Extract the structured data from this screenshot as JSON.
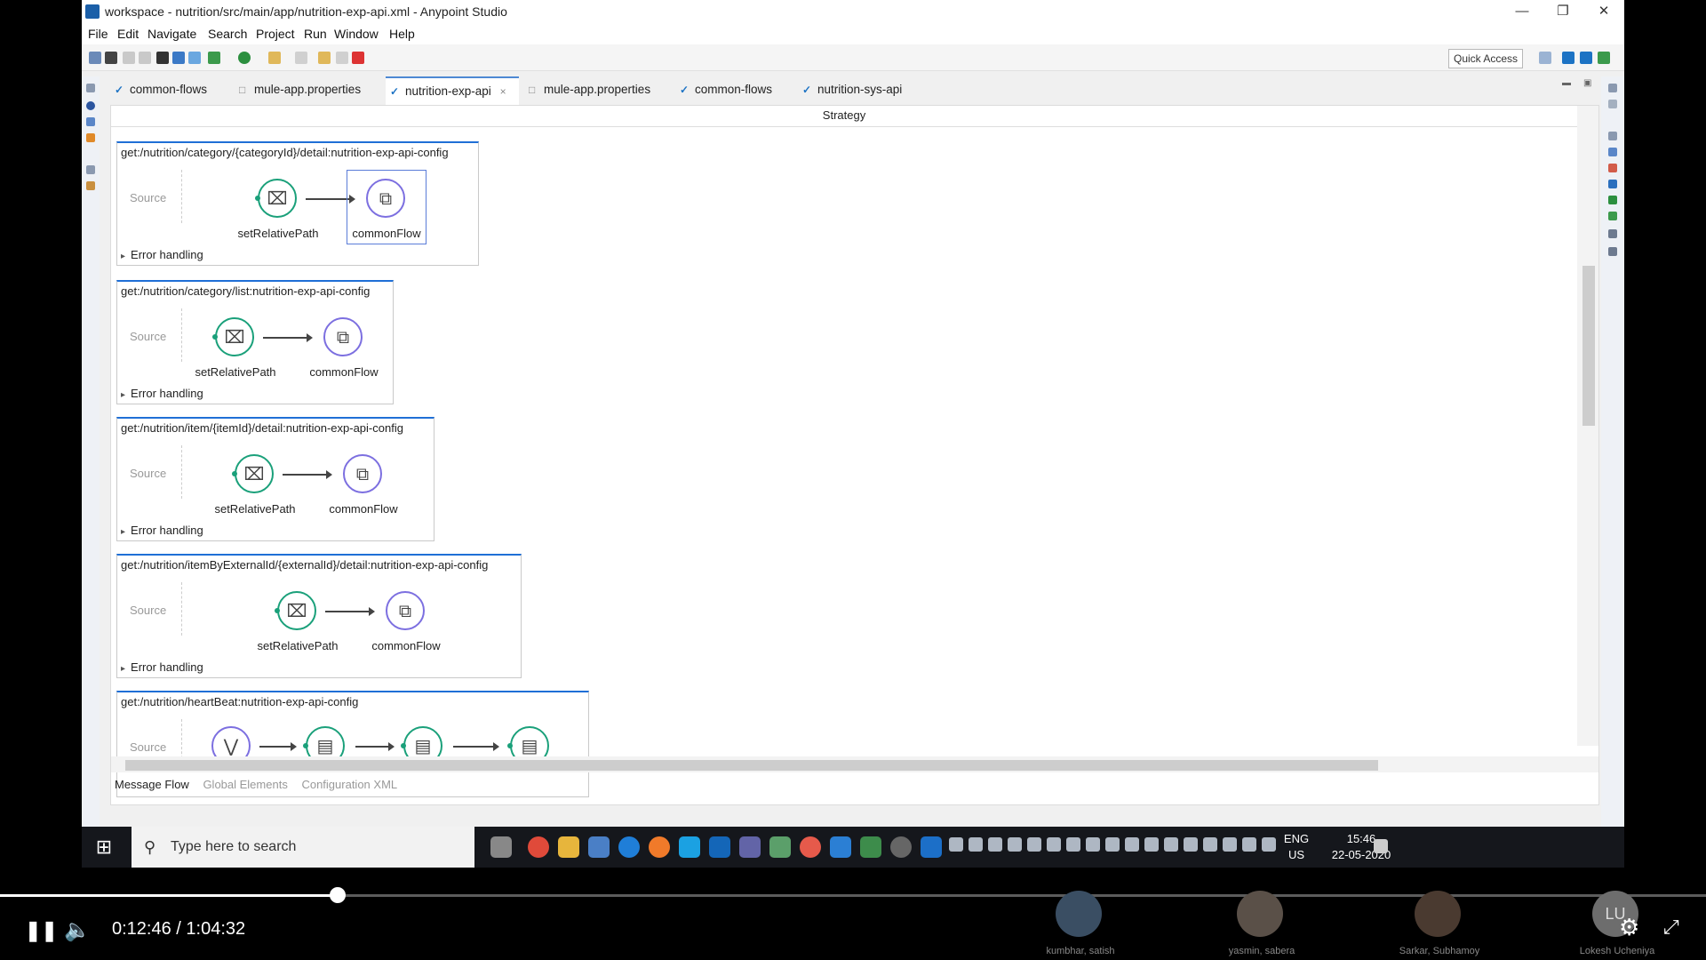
{
  "window": {
    "title": "workspace - nutrition/src/main/app/nutrition-exp-api.xml - Anypoint Studio",
    "minimize_glyph": "—",
    "restore_glyph": "❐",
    "close_glyph": "✕"
  },
  "menu": [
    "File",
    "Edit",
    "Navigate",
    "Search",
    "Project",
    "Run",
    "Window",
    "Help"
  ],
  "toolbar": {
    "quick_access": "Quick Access"
  },
  "tabs": [
    {
      "label": "common-flows",
      "icon": "mule-icon"
    },
    {
      "label": "mule-app.properties",
      "icon": "file-icon"
    },
    {
      "label": "nutrition-exp-api",
      "icon": "mule-icon",
      "active": true,
      "close": "×"
    },
    {
      "label": "mule-app.properties",
      "icon": "file-icon"
    },
    {
      "label": "common-flows",
      "icon": "mule-icon"
    },
    {
      "label": "nutrition-sys-api",
      "icon": "mule-icon"
    }
  ],
  "editor": {
    "header": "Strategy",
    "source_label": "Source",
    "error_label": "Error handling",
    "flows": [
      {
        "name": "get:/nutrition/category/{categoryId}/detail:nutrition-exp-api-config",
        "nodes": [
          "setRelativePath",
          "commonFlow"
        ]
      },
      {
        "name": "get:/nutrition/category/list:nutrition-exp-api-config",
        "nodes": [
          "setRelativePath",
          "commonFlow"
        ]
      },
      {
        "name": "get:/nutrition/item/{itemId}/detail:nutrition-exp-api-config",
        "nodes": [
          "setRelativePath",
          "commonFlow"
        ]
      },
      {
        "name": "get:/nutrition/itemByExternalId/{externalId}/detail:nutrition-exp-api-config",
        "nodes": [
          "setRelativePath",
          "commonFlow"
        ]
      },
      {
        "name": "get:/nutrition/heartBeat:nutrition-exp-api-config",
        "nodes": [
          "",
          "",
          "",
          ""
        ]
      }
    ],
    "bottom_tabs": [
      "Message Flow",
      "Global Elements",
      "Configuration XML"
    ]
  },
  "taskbar": {
    "search_placeholder": "Type here to search",
    "lang": "ENG",
    "region": "US",
    "time": "15:46",
    "date": "22-05-2020"
  },
  "video": {
    "current": "0:12:46",
    "separator": "/",
    "total": "1:04:32",
    "progress": 0.198,
    "participants": [
      "kumbhar, satish",
      "yasmin, sabera",
      "Sarkar, Subhamoy",
      "Lokesh Ucheniya"
    ],
    "participant_initials": "LU"
  },
  "colors": {
    "accent": "#1f6fd6",
    "node_green": "#1aa07a",
    "node_purple": "#7c6fe0"
  }
}
